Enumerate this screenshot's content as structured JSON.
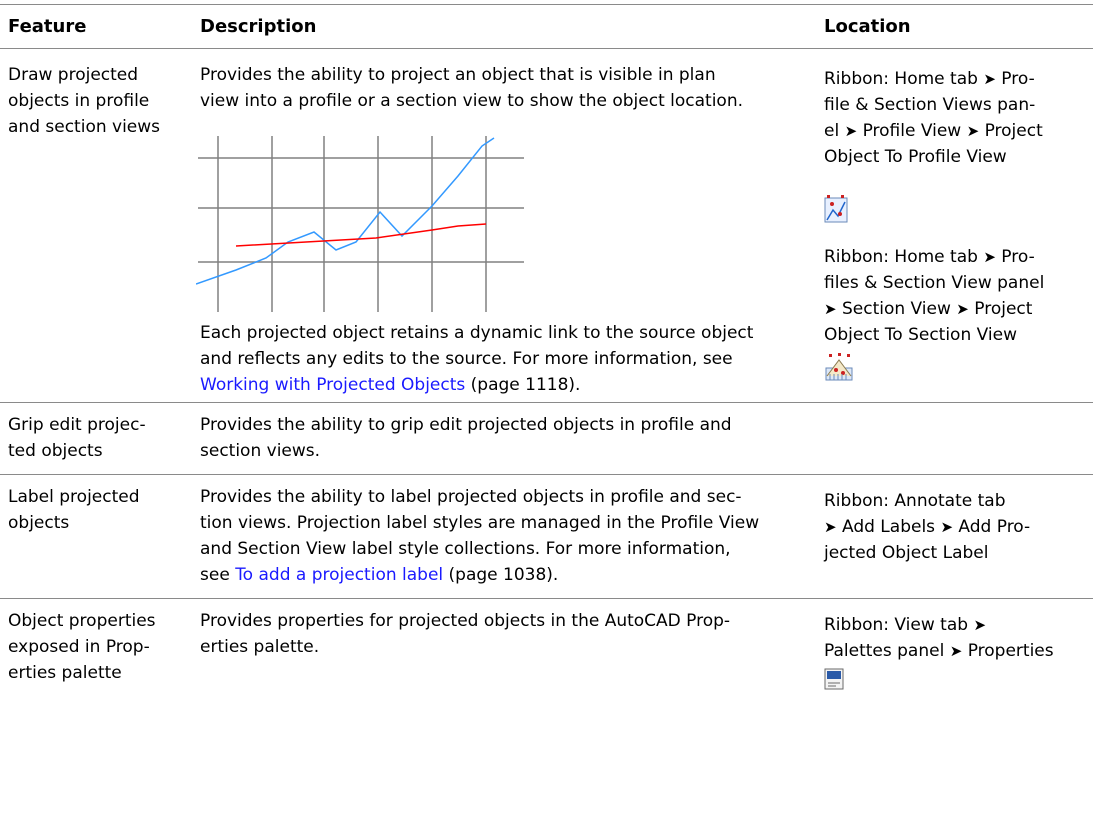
{
  "table": {
    "headers": {
      "feature": "Feature",
      "description": "Description",
      "location": "Location"
    },
    "rows": [
      {
        "feature": [
          "Draw projected",
          "objects in profile",
          "and section views"
        ],
        "description_lines": [
          "Provides the ability to project an object that is visible in plan",
          "view into a profile or a section view to show the object location."
        ],
        "description2_lines": [
          "Each projected object retains a dynamic link to the source object",
          "and reflects any edits to the source. For more information, see"
        ],
        "link_text": "Working with Projected Objects",
        "link_suffix": " (page 1118).",
        "location1_lines": [
          "Ribbon: Home tab",
          "Pro-",
          "file & Section Views pan-",
          "el",
          "Profile View",
          "Project",
          "Object To Profile View"
        ],
        "location1_icon": "project-to-profile-view-icon",
        "location2_lines": [
          "Ribbon: Home tab",
          "Pro-",
          "files & Section View panel",
          "Section View",
          "Project",
          "Object To Section View"
        ],
        "location2_icon": "project-to-section-view-icon"
      },
      {
        "feature": [
          "Grip edit projec-",
          "ted objects"
        ],
        "description_lines": [
          "Provides the ability to grip edit projected objects in profile and",
          "section views."
        ]
      },
      {
        "feature": [
          "Label projected",
          "objects"
        ],
        "description_lines": [
          "Provides the ability to label projected objects in profile and sec-",
          "tion views. Projection label styles are managed in the Profile View",
          "and Section View label style collections. For more information,"
        ],
        "link_prefix": "see ",
        "link_text": "To add a projection label",
        "link_suffix": " (page 1038).",
        "location_lines": [
          "Ribbon: Annotate tab",
          "Add Labels",
          "Add Pro-",
          "jected Object Label"
        ]
      },
      {
        "feature": [
          "Object properties",
          "exposed in Prop-",
          "erties palette"
        ],
        "description_lines": [
          "Provides properties for projected objects in the AutoCAD Prop-",
          "erties palette."
        ],
        "location_lines": [
          "Ribbon: View tab",
          "Palettes panel",
          "Properties"
        ],
        "location_icon": "properties-palette-icon"
      }
    ]
  },
  "arrow_glyph": "➤",
  "colors": {
    "link": "#1a1aff",
    "chart_red": "#ff0000",
    "chart_blue": "#3399ff",
    "grid": "#808080"
  }
}
